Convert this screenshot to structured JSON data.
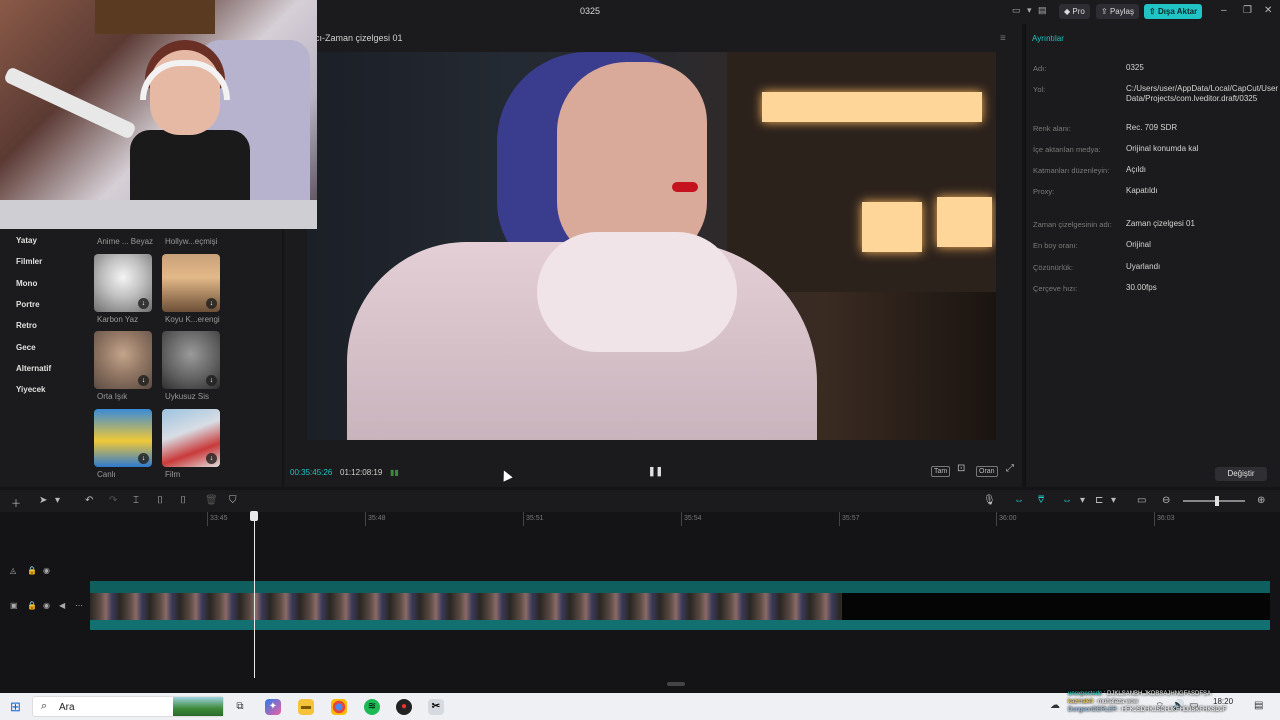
{
  "titlebar": {
    "title": "0325",
    "pro_label": "Pro",
    "share_label": "Paylaş",
    "export_label": "Dışa Aktar"
  },
  "filters": {
    "categories": [
      "Yatay",
      "Filmler",
      "Mono",
      "Portre",
      "Retro",
      "Gece",
      "Alternatif",
      "Yiyecek"
    ],
    "items": [
      {
        "label": "Anime ... Beyaz"
      },
      {
        "label": "Hollyw...eçmişi"
      },
      {
        "label": "Karbon Yaz"
      },
      {
        "label": "Koyu K...erengi"
      },
      {
        "label": "Orta Işık"
      },
      {
        "label": "Uykusuz Sis"
      },
      {
        "label": "Canlı"
      },
      {
        "label": "Film"
      }
    ]
  },
  "player": {
    "title": "cı-Zaman çizelgesi 01",
    "current_time": "00:35:45:26",
    "total_time": "01:12:08:19",
    "btn_full": "Tam",
    "btn_ratio": "Oran"
  },
  "details": {
    "title": "Ayrıntılar",
    "rows": [
      {
        "key": "Adı:",
        "value": "0325"
      },
      {
        "key": "Yol:",
        "value": "C:/Users/user/AppData/Local/CapCut/User Data/Projects/com.lveditor.draft/0325"
      },
      {
        "key": "Renk alanı:",
        "value": "Rec. 709 SDR"
      },
      {
        "key": "İçe aktarılan medya:",
        "value": "Orijinal konumda kal"
      },
      {
        "key": "Katmanları düzenleyin:",
        "value": "Açıldı"
      },
      {
        "key": "Proxy:",
        "value": "Kapatıldı"
      },
      {
        "key": "Zaman çizelgesinin adı:",
        "value": "Zaman çizelgesi 01"
      },
      {
        "key": "En boy oranı:",
        "value": "Orijinal"
      },
      {
        "key": "Çözünürlük:",
        "value": "Uyarlandı"
      },
      {
        "key": "Çerçeve hızı:",
        "value": "30.00fps"
      }
    ],
    "change_label": "Değiştir"
  },
  "timeline": {
    "ruler": [
      "33:45",
      "35:48",
      "35:51",
      "35:54",
      "35:57",
      "36:00",
      "36:03"
    ]
  },
  "taskbar": {
    "search_placeholder": "Ara",
    "clock_time": "18:20"
  },
  "chat": [
    {
      "user": "unexpectedc",
      "message": ": DJKLSANBH.JKDBSAJHNGFASDFSA"
    },
    {
      "user": "kazmaleli",
      "message": ": muhafaza wow"
    },
    {
      "user": "DungeonDERLER",
      "message": ": HFKJSDHKJSDHJKFHDJSKFHKSDJF"
    }
  ],
  "colors": {
    "accent": "#20c4c4",
    "panel": "#1b1b1d",
    "background": "#141416"
  }
}
